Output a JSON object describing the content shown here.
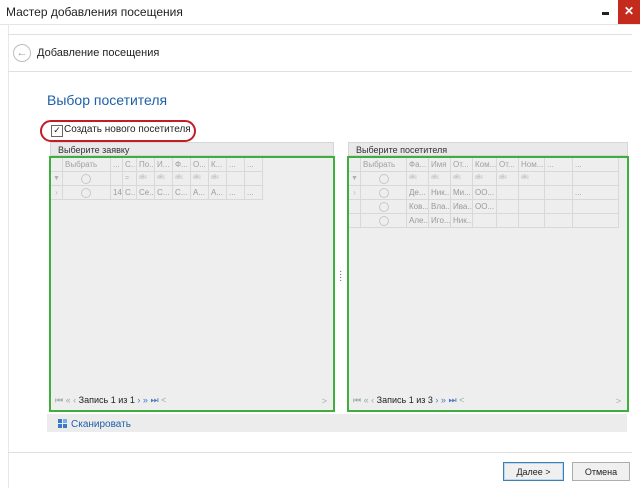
{
  "window": {
    "title": "Мастер добавления посещения",
    "close_glyph": "✕"
  },
  "header": {
    "title": "Добавление посещения",
    "back_glyph": "←"
  },
  "section_title": "Выбор посетителя",
  "create_new": {
    "label": "Создать нового посетителя",
    "checked": true,
    "check_glyph": "✓"
  },
  "left_panel": {
    "title": "Выберите заявку",
    "columns": [
      "",
      "Выбрать",
      "...",
      "С...",
      "По...",
      "И...",
      "Ф...",
      "О...",
      "К...",
      "...",
      "..."
    ],
    "filter_row": [
      "▼",
      "",
      "",
      "=",
      "ᵃᴮᶜ",
      "ᵃᴮᶜ",
      "ᵃᴮᶜ",
      "ᵃᴮᶜ",
      "ᵃᴮᶜ",
      "",
      ""
    ],
    "rows": [
      [
        "›",
        "",
        "14",
        "С...",
        "Се...",
        "С...",
        "С...",
        "А...",
        "А...",
        "...",
        "..."
      ]
    ],
    "nav_record": "Запись 1 из 1"
  },
  "right_panel": {
    "title": "Выберите посетителя",
    "columns": [
      "",
      "Выбрать",
      "Фа...",
      "Имя",
      "От...",
      "Ком...",
      "От...",
      "Ном...",
      "...",
      "..."
    ],
    "filter_row": [
      "▼",
      "",
      "ᵃᴮᶜ",
      "ᵃᴮᶜ",
      "ᵃᴮᶜ",
      "ᵃᴮᶜ",
      "ᵃᴮᶜ",
      "ᵃᴮᶜ",
      "",
      ""
    ],
    "rows": [
      [
        "›",
        "",
        "Де...",
        "Ник...",
        "Ми...",
        "ОО...",
        "",
        "",
        "",
        "..."
      ],
      [
        "",
        "",
        "Ков...",
        "Вла...",
        "Ива...",
        "ОО...",
        "",
        "",
        "",
        ""
      ],
      [
        "",
        "",
        "Але...",
        "Иго...",
        "Ник...",
        "",
        "",
        "",
        "",
        ""
      ]
    ],
    "nav_record": "Запись 1 из 3"
  },
  "nav_glyphs": {
    "first": "⏮",
    "prev_page": "«",
    "prev": "‹",
    "next": "›",
    "next_page": "»",
    "last": "⏭",
    "scroll_left": "<",
    "scroll_right": ">"
  },
  "scan": {
    "label": "Сканировать",
    "icon": "scan-icon"
  },
  "buttons": {
    "next": "Далее >",
    "cancel": "Отмена"
  },
  "colors": {
    "accent": "#1e5fa8",
    "highlight": "#c41c24",
    "panel_border": "#3fae3f"
  }
}
